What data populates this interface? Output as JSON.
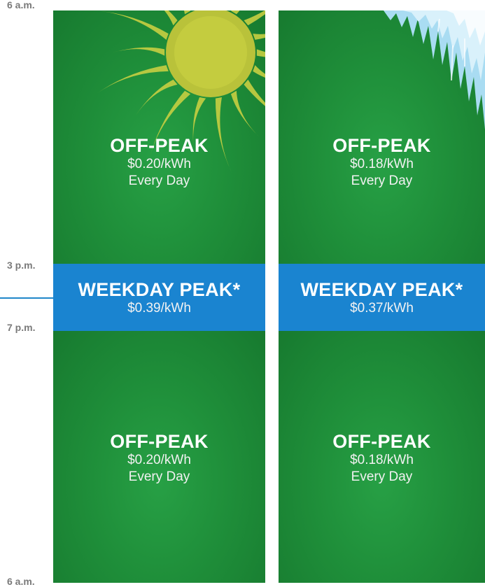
{
  "time_labels": {
    "top": "6 a.m.",
    "peak_start": "3 p.m.",
    "peak_end": "7 p.m.",
    "bottom": "6 a.m."
  },
  "colors": {
    "off_peak_green": "#1f8f3a",
    "peak_blue": "#1a84d0",
    "time_label_gray": "#7a7a7a"
  },
  "columns": [
    {
      "decoration": "sun-icon",
      "morning": {
        "title": "OFF-PEAK",
        "rate": "$0.20/kWh",
        "note": "Every Day"
      },
      "peak": {
        "title": "WEEKDAY PEAK*",
        "rate": "$0.39/kWh"
      },
      "evening": {
        "title": "OFF-PEAK",
        "rate": "$0.20/kWh",
        "note": "Every Day"
      }
    },
    {
      "decoration": "icicles-icon",
      "morning": {
        "title": "OFF-PEAK",
        "rate": "$0.18/kWh",
        "note": "Every Day"
      },
      "peak": {
        "title": "WEEKDAY PEAK*",
        "rate": "$0.37/kWh"
      },
      "evening": {
        "title": "OFF-PEAK",
        "rate": "$0.18/kWh",
        "note": "Every Day"
      }
    }
  ]
}
